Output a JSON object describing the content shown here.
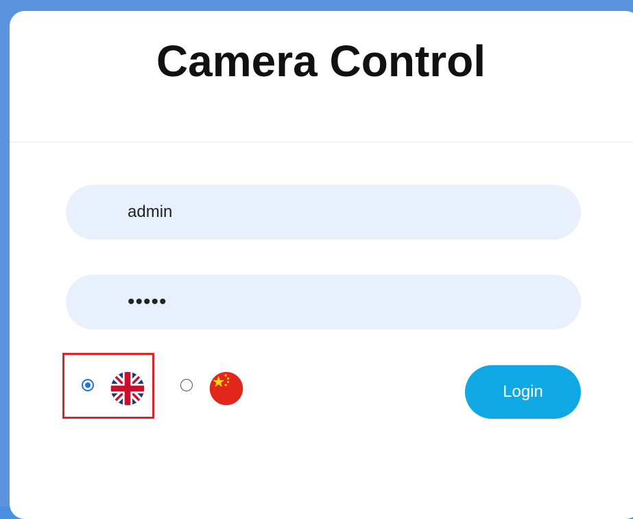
{
  "page": {
    "title": "Camera Control"
  },
  "form": {
    "username_value": "admin",
    "password_value": "•••••"
  },
  "language": {
    "options": [
      {
        "icon": "uk-flag-icon",
        "selected": true
      },
      {
        "icon": "china-flag-icon",
        "selected": false
      }
    ],
    "highlight_color": "#e02222"
  },
  "actions": {
    "login_label": "Login",
    "login_color": "#0fa8e5"
  },
  "colors": {
    "background": "#5b93dd",
    "field_fill": "#e8f0fc",
    "radio_accent": "#1a73e8"
  }
}
